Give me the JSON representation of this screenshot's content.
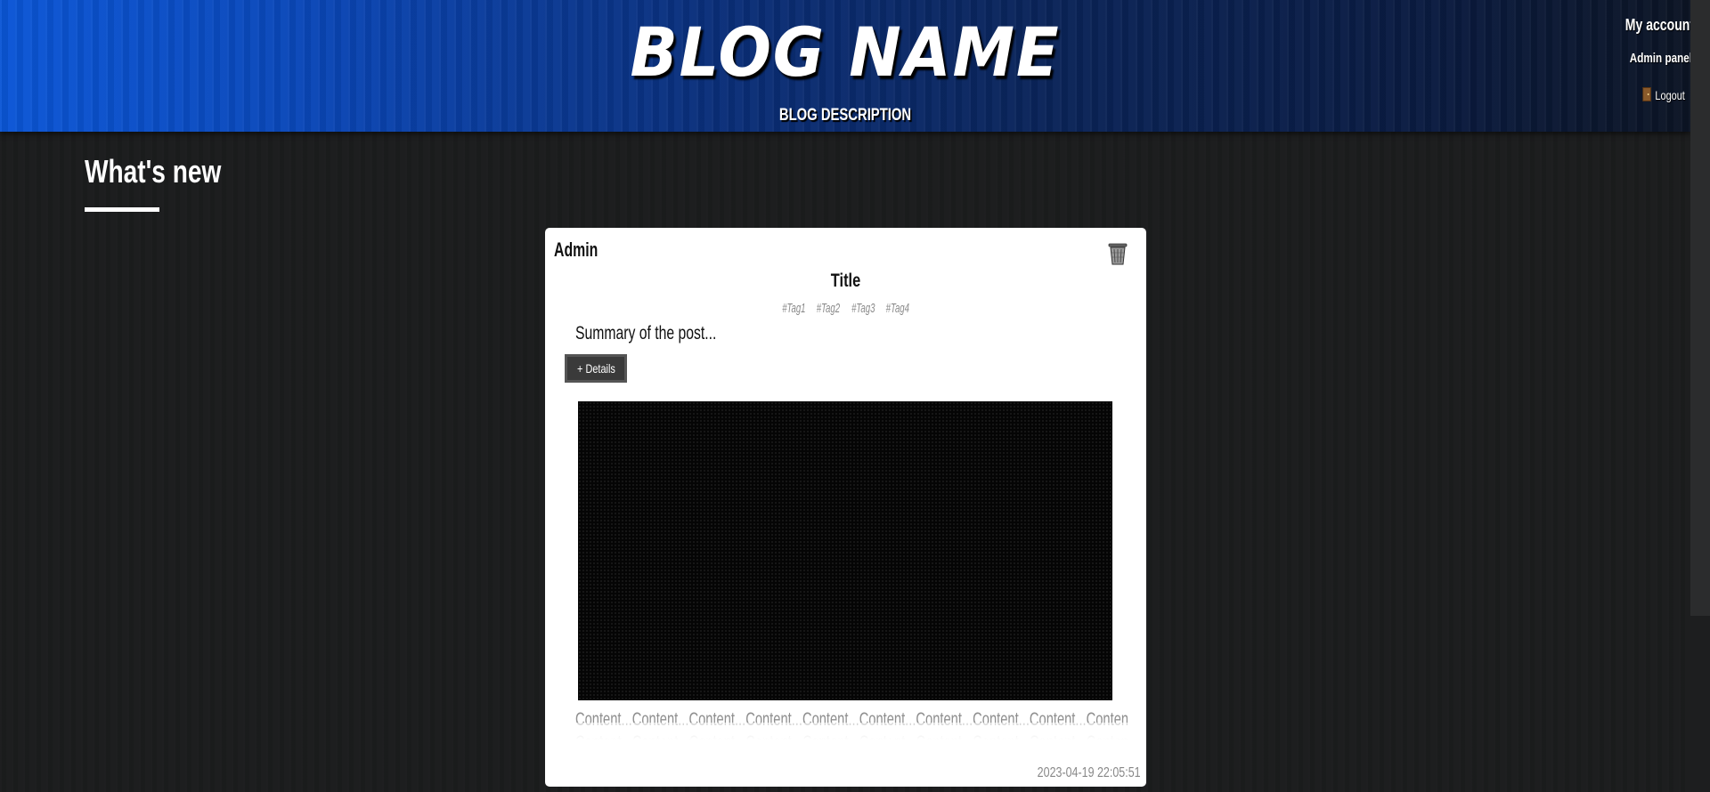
{
  "header": {
    "blog_name": "BLOG NAME",
    "blog_description": "BLOG DESCRIPTION",
    "links": {
      "my_account": "My account",
      "admin_panel": "Admin panel",
      "logout": "Logout"
    },
    "logout_icon": "door-icon"
  },
  "main": {
    "section_title": "What's new"
  },
  "post": {
    "author": "Admin",
    "title": "Title",
    "tags": [
      "#Tag1",
      "#Tag2",
      "#Tag3",
      "#Tag4"
    ],
    "summary": "Summary of the post...",
    "details_button": "+ Details",
    "content_preview": "Content...Content...Content...Content...Content...Content...Content...Content...Content...Content...",
    "timestamp": "2023-04-19 22:05:51",
    "delete_icon": "trash-icon"
  },
  "colors": {
    "header_blue": "#0b56d6",
    "page_background": "#1b1c1d",
    "card_background": "#ffffff",
    "button_background": "#3a3a3a"
  }
}
